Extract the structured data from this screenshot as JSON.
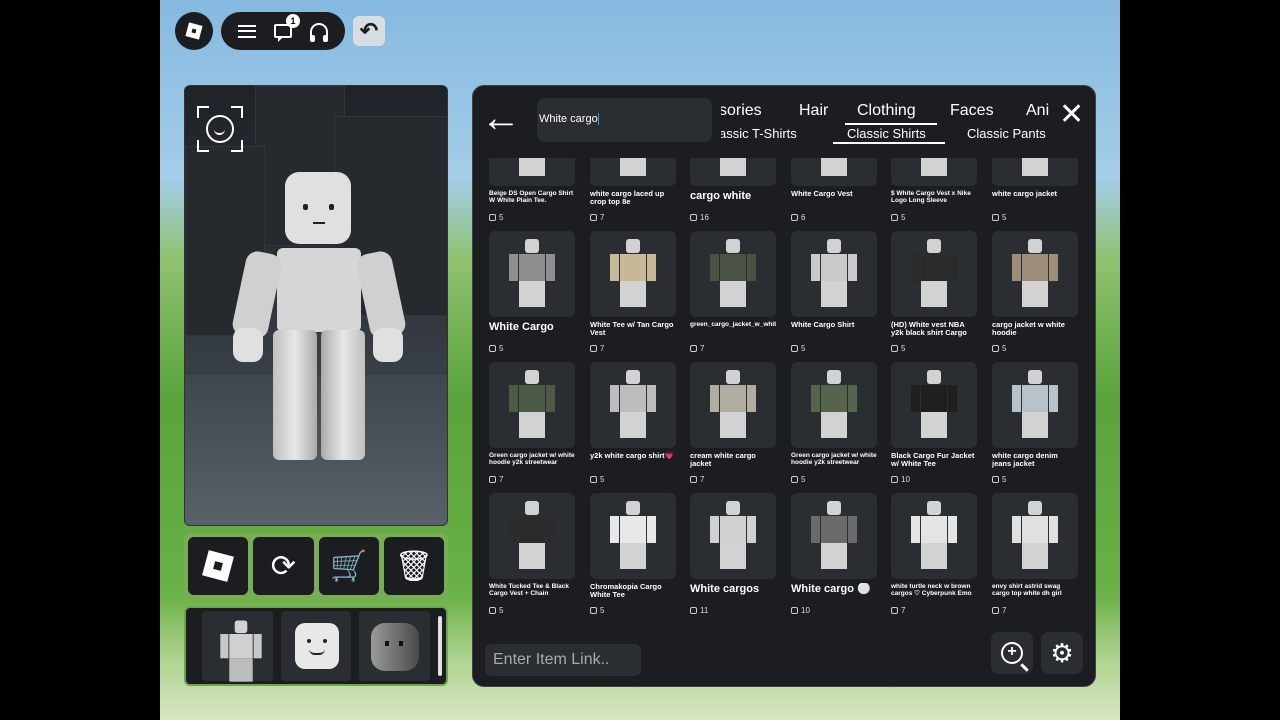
{
  "topbar": {
    "notification_count": "1",
    "icons": [
      "roblox-logo-icon",
      "hamburger-icon",
      "chat-icon",
      "headset-icon",
      "undo-icon"
    ]
  },
  "catalog": {
    "search_value": "White cargo",
    "categories": [
      "sories",
      "Hair",
      "Clothing",
      "Faces",
      "Ani"
    ],
    "active_category": "Clothing",
    "subcategories": [
      "assic T-Shirts",
      "Classic Shirts",
      "Classic Pants"
    ],
    "active_subcategory": "Classic Shirts",
    "link_placeholder": "Enter Item Link..",
    "items": [
      {
        "name": "Beige DS Open Cargo Shirt W White Plain Tee.",
        "price": "5",
        "size": "small",
        "color": "#a89a82"
      },
      {
        "name": "white cargo laced up crop top 8e",
        "price": "7",
        "size": "mid",
        "color": "#dcdcdc"
      },
      {
        "name": "cargo white",
        "price": "16",
        "size": "big",
        "color": "#e2e2e2"
      },
      {
        "name": "White Cargo Vest",
        "price": "6",
        "size": "mid",
        "color": "#e6e6e6"
      },
      {
        "name": "$ White Cargo Vest x Nike Logo Long Sleeve",
        "price": "5",
        "size": "small",
        "color": "#dadada"
      },
      {
        "name": "white cargo jacket",
        "price": "5",
        "size": "mid",
        "color": "#d8d8d8"
      },
      {
        "name": "White Cargo",
        "price": "5",
        "size": "big",
        "color": "#8e8e8e"
      },
      {
        "name": "White Tee w/ Tan Cargo Vest",
        "price": "7",
        "size": "mid",
        "color": "#c8b89a"
      },
      {
        "name": "green_cargo_jacket_w_white_t",
        "price": "7",
        "size": "tiny",
        "color": "#4a5244"
      },
      {
        "name": "White Cargo Shirt",
        "price": "5",
        "size": "mid",
        "color": "#c9c9c9"
      },
      {
        "name": "(HD) White vest NBA y2k black shirt Cargo",
        "price": "5",
        "size": "mid",
        "color": "#2a2a2a"
      },
      {
        "name": "cargo jacket w white hoodie",
        "price": "5",
        "size": "mid",
        "color": "#9c8c7a"
      },
      {
        "name": "Green cargo jacket w/ white hoodie y2k streetwear",
        "price": "7",
        "size": "small",
        "color": "#4d5a45"
      },
      {
        "name": "y2k white cargo shirt💗",
        "price": "5",
        "size": "mid",
        "color": "#bdbdbd"
      },
      {
        "name": "cream white cargo jacket",
        "price": "7",
        "size": "mid",
        "color": "#b0ac9f"
      },
      {
        "name": "Green cargo jacket w/ white hoodie y2k streetwear",
        "price": "5",
        "size": "small",
        "color": "#56644c"
      },
      {
        "name": "Black Cargo Fur Jacket w/ White Tee",
        "price": "10",
        "size": "mid",
        "color": "#1f1f1f"
      },
      {
        "name": "white cargo denim jeans jacket",
        "price": "5",
        "size": "mid",
        "color": "#b9c2c8"
      },
      {
        "name": "White Tucked Tee & Black Cargo Vest + Chain",
        "price": "5",
        "size": "small",
        "color": "#2b2b2b"
      },
      {
        "name": "Chromakopia Cargo White Tee",
        "price": "5",
        "size": "mid",
        "color": "#e8e8e8"
      },
      {
        "name": "White cargos",
        "price": "11",
        "size": "big",
        "color": "#d0d0d0"
      },
      {
        "name": "White cargo ⚪",
        "price": "10",
        "size": "big",
        "color": "#6a6a6a"
      },
      {
        "name": "white turtle neck w brown cargos ♡ Cyberpunk Emo",
        "price": "7",
        "size": "small",
        "color": "#e4e4e4"
      },
      {
        "name": "envy shirt astrid swag cargo top white dh girl",
        "price": "7",
        "size": "small",
        "color": "#e0e0e0"
      }
    ]
  },
  "colors": {
    "panel": "#1b1d20",
    "tile": "#2a2d31",
    "accent_green": "#76ad55"
  }
}
